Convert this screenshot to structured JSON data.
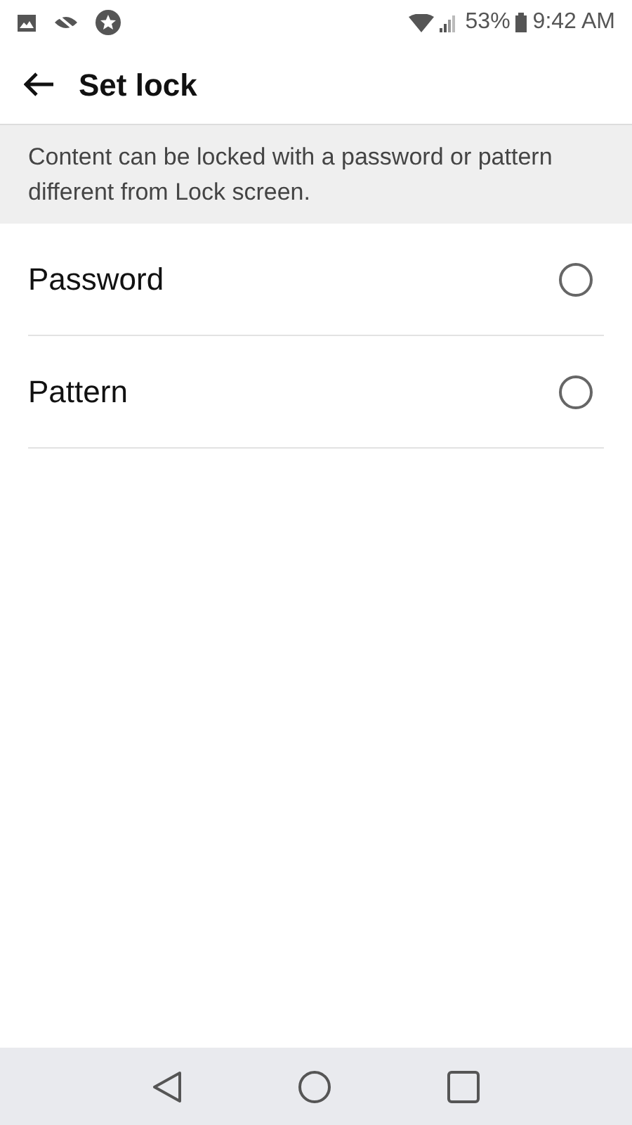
{
  "status_bar": {
    "battery": "53%",
    "time": "9:42 AM"
  },
  "app_bar": {
    "title": "Set lock"
  },
  "description": "Content can be locked with a password or pattern different from Lock screen.",
  "options": [
    {
      "label": "Password",
      "selected": false
    },
    {
      "label": "Pattern",
      "selected": false
    }
  ]
}
